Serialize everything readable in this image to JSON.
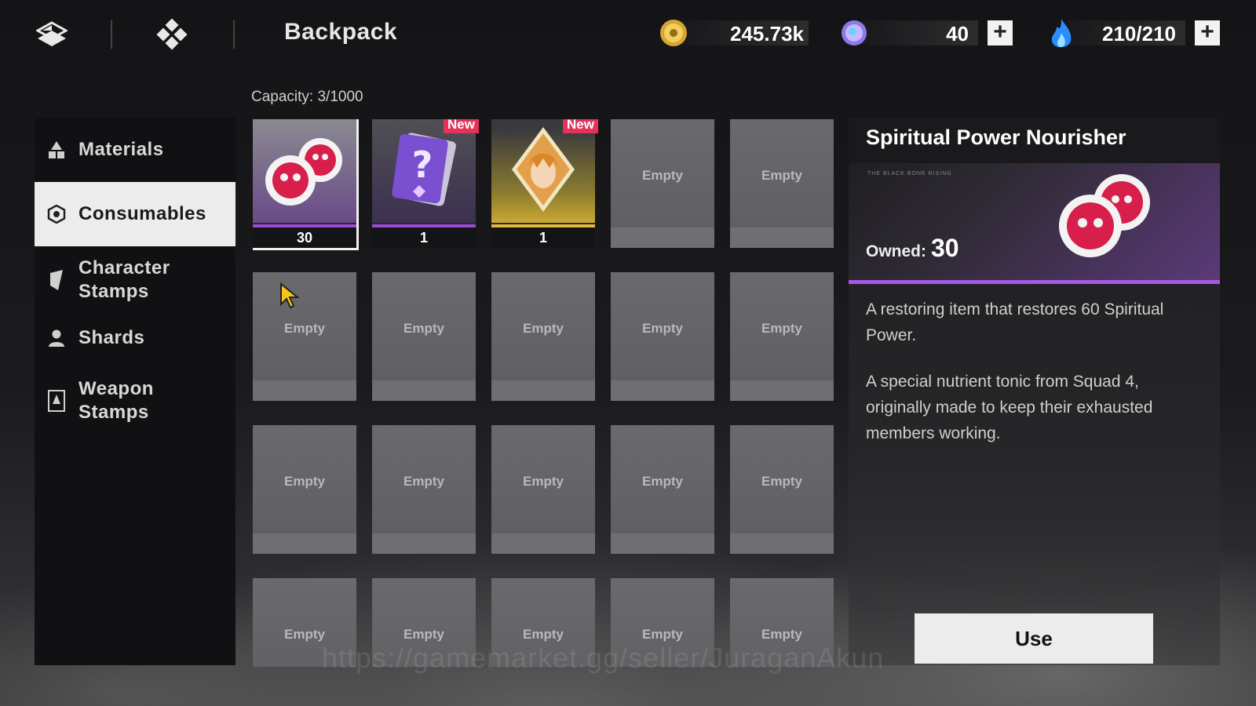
{
  "header": {
    "title": "Backpack",
    "nav_icons": [
      "back-icon",
      "home-icon"
    ]
  },
  "currencies": [
    {
      "name": "gold-coin",
      "value": "245.73k",
      "has_plus": false
    },
    {
      "name": "premium-gem",
      "value": "40",
      "has_plus": true
    },
    {
      "name": "energy-flame",
      "value": "210/210",
      "has_plus": true
    }
  ],
  "sidebar": {
    "items": [
      {
        "label": "Materials",
        "icon": "materials-icon",
        "active": false
      },
      {
        "label": "Consumables",
        "icon": "consumables-icon",
        "active": true
      },
      {
        "label": "Character\nStamps",
        "icon": "character-stamp-icon",
        "active": false
      },
      {
        "label": "Shards",
        "icon": "shard-icon",
        "active": false
      },
      {
        "label": "Weapon\nStamps",
        "icon": "weapon-stamp-icon",
        "active": false
      }
    ]
  },
  "inventory": {
    "capacity_label": "Capacity: 3/1000",
    "empty_label": "Empty",
    "new_label": "New",
    "items": [
      {
        "name": "spiritual-power-nourisher",
        "count": "30",
        "is_new": false,
        "selected": true
      },
      {
        "name": "mystery-card-pack",
        "count": "1",
        "is_new": true,
        "selected": false
      },
      {
        "name": "character-portrait-ticket",
        "count": "1",
        "is_new": true,
        "selected": false
      }
    ]
  },
  "detail": {
    "title": "Spiritual Power Nourisher",
    "owned_label": "Owned:",
    "owned_value": "30",
    "tiny_text": "THE BLACK BONE RISING",
    "description_1": "A restoring item that restores 60 Spiritual Power.",
    "description_2": "A special nutrient tonic from Squad 4, originally made to keep their exhausted members working.",
    "use_label": "Use"
  },
  "watermark": "https://gamemarket.gg/seller/JuraganAkun",
  "colors": {
    "rarity_purple": "#9b4ad8",
    "new_badge": "#e5325a",
    "active_tab_bg": "#ececec"
  }
}
